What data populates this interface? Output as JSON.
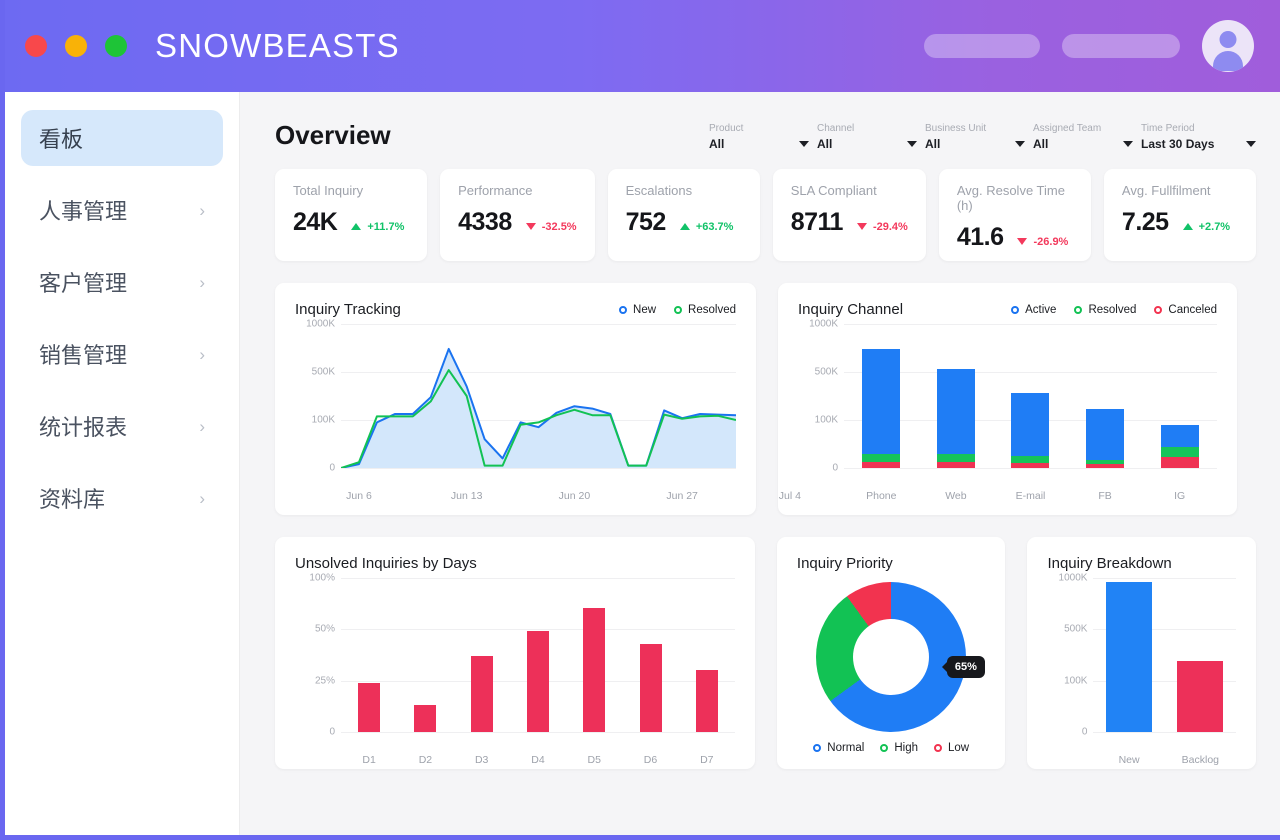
{
  "titlebar": {
    "brand": "SNOWBEASTS",
    "lights": [
      "close",
      "minimize",
      "maximize"
    ]
  },
  "sidebar": {
    "items": [
      {
        "label": "看板",
        "active": true,
        "chevron": ""
      },
      {
        "label": "人事管理",
        "active": false,
        "chevron": "›"
      },
      {
        "label": "客户管理",
        "active": false,
        "chevron": "›"
      },
      {
        "label": "销售管理",
        "active": false,
        "chevron": "›"
      },
      {
        "label": "统计报表",
        "active": false,
        "chevron": "›"
      },
      {
        "label": "资料库",
        "active": false,
        "chevron": "›"
      }
    ]
  },
  "header": {
    "title": "Overview",
    "filters": [
      {
        "label": "Product",
        "value": "All"
      },
      {
        "label": "Channel",
        "value": "All"
      },
      {
        "label": "Business Unit",
        "value": "All"
      },
      {
        "label": "Assigned Team",
        "value": "All"
      },
      {
        "label": "Time Period",
        "value": "Last 30 Days"
      }
    ]
  },
  "kpis": [
    {
      "label": "Total Inquiry",
      "value": "24K",
      "delta": "+11.7%",
      "direction": "up"
    },
    {
      "label": "Performance",
      "value": "4338",
      "delta": "-32.5%",
      "direction": "down"
    },
    {
      "label": "Escalations",
      "value": "752",
      "delta": "+63.7%",
      "direction": "up"
    },
    {
      "label": "SLA Compliant",
      "value": "8711",
      "delta": "-29.4%",
      "direction": "down"
    },
    {
      "label": "Avg. Resolve Time (h)",
      "value": "41.6",
      "delta": "-26.9%",
      "direction": "down"
    },
    {
      "label": "Avg. Fullfilment",
      "value": "7.25",
      "delta": "+2.7%",
      "direction": "up"
    }
  ],
  "colors": {
    "blue": "#1f7df5",
    "green": "#12c254",
    "red": "#ef3354",
    "brand_purple": "#6d6af2",
    "up": "#11c268",
    "down": "#f3395c"
  },
  "chart_data": [
    {
      "id": "inquiry-tracking",
      "type": "area",
      "title": "Inquiry Tracking",
      "xlabel": "",
      "ylabel": "",
      "ylim": [
        0,
        1000
      ],
      "ytick_labels": [
        "0",
        "100K",
        "500K",
        "1000K"
      ],
      "ytick_values": [
        0,
        100,
        500,
        1000
      ],
      "grid": true,
      "legend_position": "top-right",
      "xtick_labels": [
        "Jun 6",
        "Jun 13",
        "Jun 20",
        "Jun 27",
        "Jul 4"
      ],
      "xtick_index": [
        1,
        7,
        13,
        19,
        25
      ],
      "series": [
        {
          "name": "New",
          "color": "#1a73f0",
          "values": [
            0,
            8,
            95,
            150,
            150,
            290,
            740,
            380,
            60,
            20,
            95,
            85,
            160,
            215,
            195,
            150,
            5,
            5,
            180,
            115,
            150,
            145,
            140
          ]
        },
        {
          "name": "Resolved",
          "color": "#12c254",
          "values": [
            0,
            12,
            130,
            130,
            130,
            255,
            520,
            300,
            5,
            5,
            90,
            95,
            140,
            185,
            140,
            140,
            5,
            5,
            145,
            110,
            130,
            135,
            100
          ]
        }
      ]
    },
    {
      "id": "inquiry-channel",
      "type": "bar",
      "title": "Inquiry Channel",
      "stacked": true,
      "categories": [
        "Phone",
        "Web",
        "E-mail",
        "FB",
        "IG"
      ],
      "ylim": [
        0,
        1000
      ],
      "ytick_labels": [
        "0",
        "100K",
        "500K",
        "1000K"
      ],
      "ytick_values": [
        0,
        100,
        500,
        1000
      ],
      "grid": true,
      "legend_position": "top-right",
      "series": [
        {
          "name": "Canceled",
          "color": "#ef3354",
          "values": [
            62,
            53,
            42,
            33,
            22
          ]
        },
        {
          "name": "Resolved",
          "color": "#15c45a",
          "values": [
            88,
            67,
            55,
            32,
            22
          ]
        },
        {
          "name": "Active",
          "color": "#1f7df5",
          "values": [
            590,
            410,
            230,
            130,
            45
          ]
        }
      ]
    },
    {
      "id": "unsolved-inquiries",
      "type": "bar",
      "title": "Unsolved Inquiries by Days",
      "categories": [
        "D1",
        "D2",
        "D3",
        "D4",
        "D5",
        "D6",
        "D7"
      ],
      "values": [
        24,
        13,
        37,
        49,
        71,
        43,
        30
      ],
      "ylim": [
        0,
        100
      ],
      "ytick_labels": [
        "0",
        "25%",
        "50%",
        "100%"
      ],
      "ytick_values": [
        0,
        25,
        50,
        100
      ],
      "grid": true,
      "bar_color": "#ed3059"
    },
    {
      "id": "inquiry-priority",
      "type": "pie",
      "title": "Inquiry Priority",
      "labels": [
        "Normal",
        "High",
        "Low"
      ],
      "values": [
        65,
        25,
        10
      ],
      "colors": [
        "#1f7df5",
        "#12c254",
        "#f2334f"
      ],
      "annotation": "65%",
      "legend_position": "bottom"
    },
    {
      "id": "inquiry-breakdown",
      "type": "bar",
      "title": "Inquiry Breakdown",
      "categories": [
        "New",
        "Backlog"
      ],
      "values": [
        960,
        250
      ],
      "colors": [
        "#2183f5",
        "#ed3059"
      ],
      "ylim": [
        0,
        1000
      ],
      "ytick_labels": [
        "0",
        "100K",
        "500K",
        "1000K"
      ],
      "ytick_values": [
        0,
        100,
        500,
        1000
      ],
      "grid": true
    }
  ]
}
